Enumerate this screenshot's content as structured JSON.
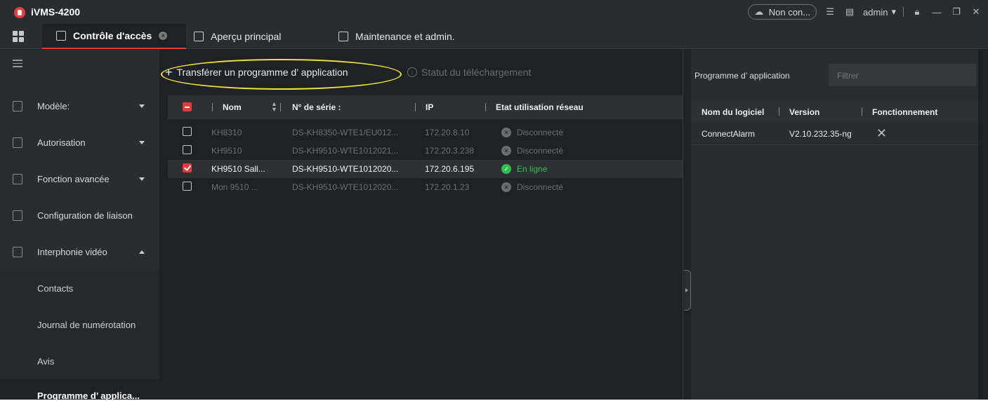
{
  "app": {
    "title": "iVMS-4200"
  },
  "titlebar": {
    "network_status": "Non con...",
    "user": "admin"
  },
  "tabs": [
    {
      "label": "Contrôle d'accès",
      "active": true
    },
    {
      "label": "Aperçu principal",
      "active": false
    },
    {
      "label": "Maintenance et admin.",
      "active": false
    }
  ],
  "sidebar": {
    "items": [
      {
        "label": "Modèle:",
        "expanded": false
      },
      {
        "label": "Autorisation",
        "expanded": false
      },
      {
        "label": "Fonction avancée",
        "expanded": false
      },
      {
        "label": "Configuration de liaison"
      },
      {
        "label": "Interphonie vidéo",
        "expanded": true
      }
    ],
    "subitems": [
      {
        "label": "Contacts"
      },
      {
        "label": "Journal de numérotation"
      },
      {
        "label": "Avis"
      },
      {
        "label": "Programme d’ applica..."
      }
    ]
  },
  "toolbar": {
    "upload_label": "Transférer un programme d’ application",
    "status_label": "Statut du téléchargement"
  },
  "device_table": {
    "headers": [
      "Nom",
      "N° de série :",
      "IP",
      "Etat utilisation réseau"
    ],
    "rows": [
      {
        "name": "KH8310",
        "serial": "DS-KH8350-WTE1/EU012...",
        "ip": "172.20.8.10",
        "status": "Disconnecté",
        "online": false,
        "checked": false
      },
      {
        "name": "KH9510",
        "serial": "DS-KH9510-WTE1012021...",
        "ip": "172.20.3.238",
        "status": "Disconnecté",
        "online": false,
        "checked": false
      },
      {
        "name": "KH9510 Sall...",
        "serial": "DS-KH9510-WTE1012020...",
        "ip": "172.20.6.195",
        "status": "En ligne",
        "online": true,
        "checked": true
      },
      {
        "name": "Mon 9510 ...",
        "serial": "DS-KH9510-WTE1012020...",
        "ip": "172.20.1.23",
        "status": "Disconnecté",
        "online": false,
        "checked": false
      }
    ]
  },
  "right_panel": {
    "title": "Programme d’ application",
    "filter_placeholder": "Filtrer",
    "headers": [
      "Nom du logiciel",
      "Version",
      "Fonctionnement"
    ],
    "rows": [
      {
        "name": "ConnectAlarm",
        "version": "V2.10.232.35-ng"
      }
    ]
  },
  "colors": {
    "accent": "#e23a3a",
    "online": "#2fbf50",
    "highlight": "#f1e23a"
  }
}
